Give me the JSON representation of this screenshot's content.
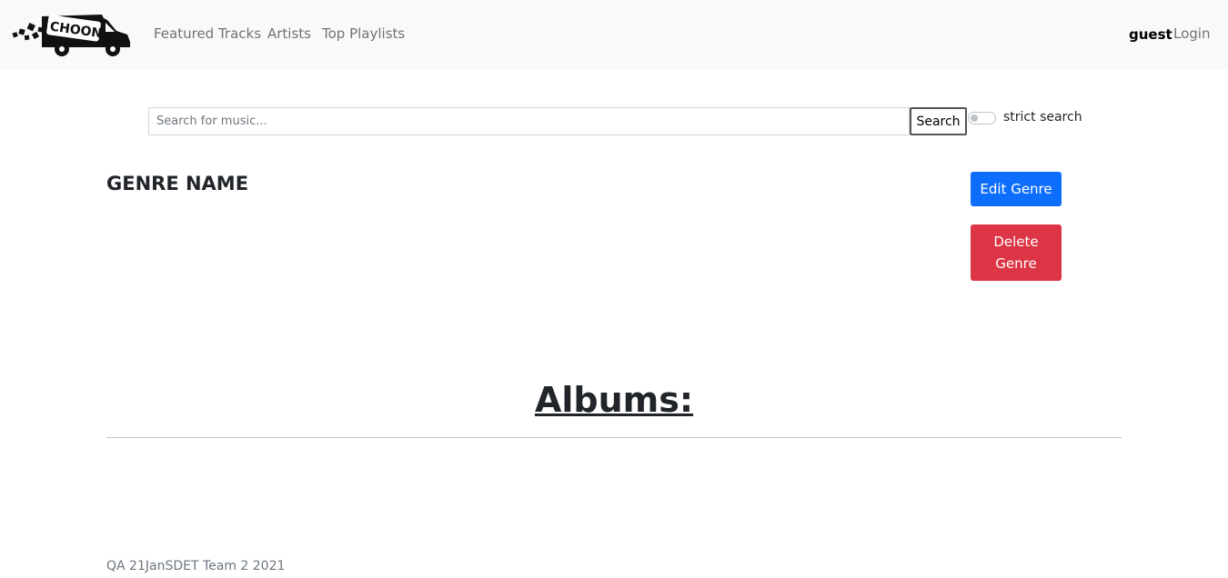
{
  "navbar": {
    "logo_text": "CHOONZ",
    "links": [
      "Featured Tracks",
      "Artists",
      "Top Playlists"
    ],
    "user": "guest",
    "login": "Login"
  },
  "search": {
    "placeholder": "Search for music...",
    "value": "",
    "button_label": "Search",
    "strict_label": "strict search",
    "strict_enabled": false
  },
  "genre": {
    "name": "GENRE NAME",
    "edit_label": "Edit Genre",
    "delete_label": "Delete Genre"
  },
  "albums": {
    "heading": "Albums:"
  },
  "footer": {
    "text": "QA 21JanSDET Team 2 2021"
  },
  "colors": {
    "navbar_bg": "#f8f9fa",
    "primary": "#0d6efd",
    "danger": "#dc3545"
  }
}
